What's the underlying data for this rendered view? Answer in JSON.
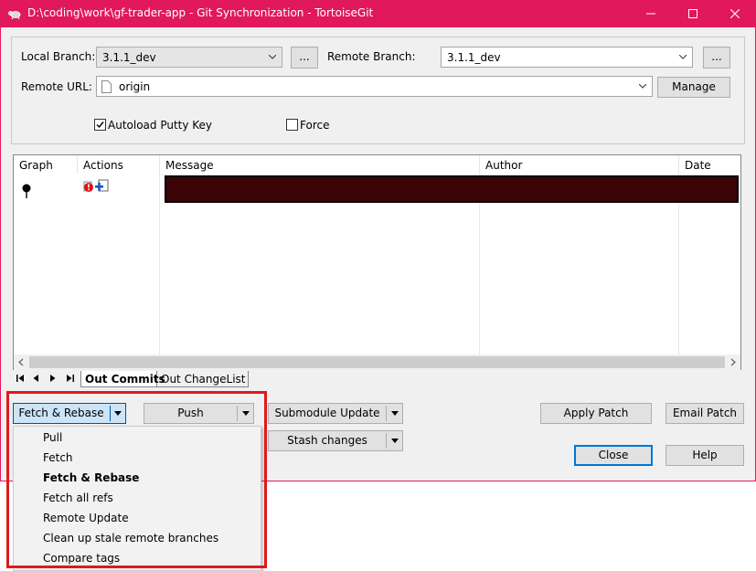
{
  "window": {
    "title": "D:\\coding\\work\\gf-trader-app - Git Synchronization - TortoiseGit",
    "icons": {
      "app": "tortoise-icon",
      "minimize": "minimize-icon",
      "maximize": "maximize-icon",
      "close": "close-icon"
    },
    "colors": {
      "titlebar": "#e2185c",
      "highlight_box": "#e0191b"
    }
  },
  "form": {
    "local_branch_label": "Local Branch:",
    "local_branch_value": "3.1.1_dev",
    "local_browse_label": "...",
    "remote_branch_label": "Remote Branch:",
    "remote_branch_value": "3.1.1_dev",
    "remote_browse_label": "...",
    "remote_url_label": "Remote URL:",
    "remote_url_value": "origin",
    "manage_label": "Manage",
    "autoload_label": "Autoload Putty Key",
    "autoload_checked": true,
    "force_label": "Force",
    "force_checked": false
  },
  "list": {
    "columns": [
      "Graph",
      "Actions",
      "Message",
      "Author",
      "Date"
    ]
  },
  "tabs": [
    {
      "label": "Out Commits",
      "active": true
    },
    {
      "label": "Out ChangeList",
      "active": false
    }
  ],
  "buttons": {
    "fetch_rebase": "Fetch & Rebase",
    "push": "Push",
    "submodule_update": "Submodule Update",
    "stash_changes": "Stash changes",
    "apply_patch": "Apply Patch",
    "email_patch": "Email Patch",
    "close": "Close",
    "help": "Help"
  },
  "menu": {
    "items": [
      {
        "label": "Pull",
        "bold": false
      },
      {
        "label": "Fetch",
        "bold": false
      },
      {
        "label": "Fetch & Rebase",
        "bold": true
      },
      {
        "label": "Fetch all refs",
        "bold": false
      },
      {
        "label": "Remote Update",
        "bold": false
      },
      {
        "label": "Clean up stale remote branches",
        "bold": false
      },
      {
        "label": "Compare tags",
        "bold": false
      }
    ]
  }
}
